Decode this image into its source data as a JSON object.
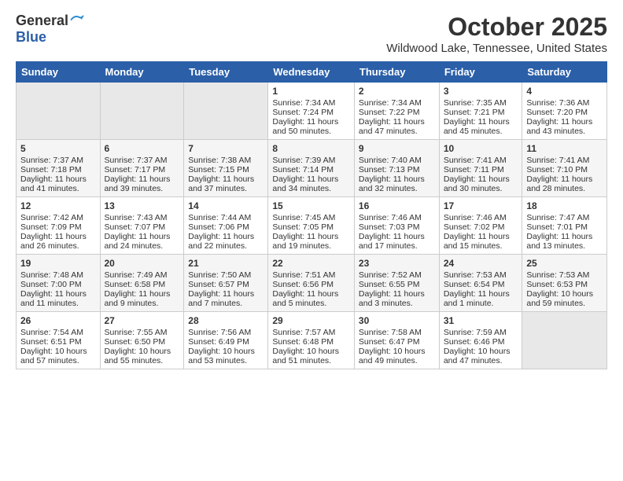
{
  "header": {
    "logo_general": "General",
    "logo_blue": "Blue",
    "month_title": "October 2025",
    "location": "Wildwood Lake, Tennessee, United States"
  },
  "days_of_week": [
    "Sunday",
    "Monday",
    "Tuesday",
    "Wednesday",
    "Thursday",
    "Friday",
    "Saturday"
  ],
  "weeks": [
    [
      {
        "day": "",
        "sunrise": "",
        "sunset": "",
        "daylight": "",
        "empty": true
      },
      {
        "day": "",
        "sunrise": "",
        "sunset": "",
        "daylight": "",
        "empty": true
      },
      {
        "day": "",
        "sunrise": "",
        "sunset": "",
        "daylight": "",
        "empty": true
      },
      {
        "day": "1",
        "sunrise": "Sunrise: 7:34 AM",
        "sunset": "Sunset: 7:24 PM",
        "daylight": "Daylight: 11 hours and 50 minutes."
      },
      {
        "day": "2",
        "sunrise": "Sunrise: 7:34 AM",
        "sunset": "Sunset: 7:22 PM",
        "daylight": "Daylight: 11 hours and 47 minutes."
      },
      {
        "day": "3",
        "sunrise": "Sunrise: 7:35 AM",
        "sunset": "Sunset: 7:21 PM",
        "daylight": "Daylight: 11 hours and 45 minutes."
      },
      {
        "day": "4",
        "sunrise": "Sunrise: 7:36 AM",
        "sunset": "Sunset: 7:20 PM",
        "daylight": "Daylight: 11 hours and 43 minutes."
      }
    ],
    [
      {
        "day": "5",
        "sunrise": "Sunrise: 7:37 AM",
        "sunset": "Sunset: 7:18 PM",
        "daylight": "Daylight: 11 hours and 41 minutes."
      },
      {
        "day": "6",
        "sunrise": "Sunrise: 7:37 AM",
        "sunset": "Sunset: 7:17 PM",
        "daylight": "Daylight: 11 hours and 39 minutes."
      },
      {
        "day": "7",
        "sunrise": "Sunrise: 7:38 AM",
        "sunset": "Sunset: 7:15 PM",
        "daylight": "Daylight: 11 hours and 37 minutes."
      },
      {
        "day": "8",
        "sunrise": "Sunrise: 7:39 AM",
        "sunset": "Sunset: 7:14 PM",
        "daylight": "Daylight: 11 hours and 34 minutes."
      },
      {
        "day": "9",
        "sunrise": "Sunrise: 7:40 AM",
        "sunset": "Sunset: 7:13 PM",
        "daylight": "Daylight: 11 hours and 32 minutes."
      },
      {
        "day": "10",
        "sunrise": "Sunrise: 7:41 AM",
        "sunset": "Sunset: 7:11 PM",
        "daylight": "Daylight: 11 hours and 30 minutes."
      },
      {
        "day": "11",
        "sunrise": "Sunrise: 7:41 AM",
        "sunset": "Sunset: 7:10 PM",
        "daylight": "Daylight: 11 hours and 28 minutes."
      }
    ],
    [
      {
        "day": "12",
        "sunrise": "Sunrise: 7:42 AM",
        "sunset": "Sunset: 7:09 PM",
        "daylight": "Daylight: 11 hours and 26 minutes."
      },
      {
        "day": "13",
        "sunrise": "Sunrise: 7:43 AM",
        "sunset": "Sunset: 7:07 PM",
        "daylight": "Daylight: 11 hours and 24 minutes."
      },
      {
        "day": "14",
        "sunrise": "Sunrise: 7:44 AM",
        "sunset": "Sunset: 7:06 PM",
        "daylight": "Daylight: 11 hours and 22 minutes."
      },
      {
        "day": "15",
        "sunrise": "Sunrise: 7:45 AM",
        "sunset": "Sunset: 7:05 PM",
        "daylight": "Daylight: 11 hours and 19 minutes."
      },
      {
        "day": "16",
        "sunrise": "Sunrise: 7:46 AM",
        "sunset": "Sunset: 7:03 PM",
        "daylight": "Daylight: 11 hours and 17 minutes."
      },
      {
        "day": "17",
        "sunrise": "Sunrise: 7:46 AM",
        "sunset": "Sunset: 7:02 PM",
        "daylight": "Daylight: 11 hours and 15 minutes."
      },
      {
        "day": "18",
        "sunrise": "Sunrise: 7:47 AM",
        "sunset": "Sunset: 7:01 PM",
        "daylight": "Daylight: 11 hours and 13 minutes."
      }
    ],
    [
      {
        "day": "19",
        "sunrise": "Sunrise: 7:48 AM",
        "sunset": "Sunset: 7:00 PM",
        "daylight": "Daylight: 11 hours and 11 minutes."
      },
      {
        "day": "20",
        "sunrise": "Sunrise: 7:49 AM",
        "sunset": "Sunset: 6:58 PM",
        "daylight": "Daylight: 11 hours and 9 minutes."
      },
      {
        "day": "21",
        "sunrise": "Sunrise: 7:50 AM",
        "sunset": "Sunset: 6:57 PM",
        "daylight": "Daylight: 11 hours and 7 minutes."
      },
      {
        "day": "22",
        "sunrise": "Sunrise: 7:51 AM",
        "sunset": "Sunset: 6:56 PM",
        "daylight": "Daylight: 11 hours and 5 minutes."
      },
      {
        "day": "23",
        "sunrise": "Sunrise: 7:52 AM",
        "sunset": "Sunset: 6:55 PM",
        "daylight": "Daylight: 11 hours and 3 minutes."
      },
      {
        "day": "24",
        "sunrise": "Sunrise: 7:53 AM",
        "sunset": "Sunset: 6:54 PM",
        "daylight": "Daylight: 11 hours and 1 minute."
      },
      {
        "day": "25",
        "sunrise": "Sunrise: 7:53 AM",
        "sunset": "Sunset: 6:53 PM",
        "daylight": "Daylight: 10 hours and 59 minutes."
      }
    ],
    [
      {
        "day": "26",
        "sunrise": "Sunrise: 7:54 AM",
        "sunset": "Sunset: 6:51 PM",
        "daylight": "Daylight: 10 hours and 57 minutes."
      },
      {
        "day": "27",
        "sunrise": "Sunrise: 7:55 AM",
        "sunset": "Sunset: 6:50 PM",
        "daylight": "Daylight: 10 hours and 55 minutes."
      },
      {
        "day": "28",
        "sunrise": "Sunrise: 7:56 AM",
        "sunset": "Sunset: 6:49 PM",
        "daylight": "Daylight: 10 hours and 53 minutes."
      },
      {
        "day": "29",
        "sunrise": "Sunrise: 7:57 AM",
        "sunset": "Sunset: 6:48 PM",
        "daylight": "Daylight: 10 hours and 51 minutes."
      },
      {
        "day": "30",
        "sunrise": "Sunrise: 7:58 AM",
        "sunset": "Sunset: 6:47 PM",
        "daylight": "Daylight: 10 hours and 49 minutes."
      },
      {
        "day": "31",
        "sunrise": "Sunrise: 7:59 AM",
        "sunset": "Sunset: 6:46 PM",
        "daylight": "Daylight: 10 hours and 47 minutes."
      },
      {
        "day": "",
        "sunrise": "",
        "sunset": "",
        "daylight": "",
        "empty": true
      }
    ]
  ]
}
